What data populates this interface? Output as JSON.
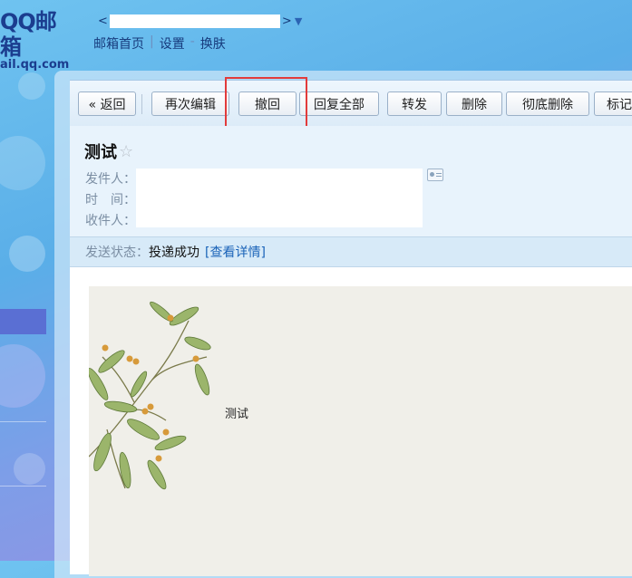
{
  "header": {
    "logo_main": "QQ邮箱",
    "logo_sub": "ail.qq.com",
    "account_open": "<",
    "account_close": ">",
    "account_caret": "▼",
    "nav": [
      {
        "label": "邮箱首页"
      },
      {
        "label": "设置"
      },
      {
        "label": "换肤"
      }
    ],
    "nav_separators": [
      "|",
      "-"
    ]
  },
  "toolbar": {
    "back": "« 返回",
    "reedit": "再次编辑",
    "recall": "撤回",
    "reply_all": "回复全部",
    "forward": "转发",
    "delete": "删除",
    "delete_forever": "彻底删除",
    "mark": "标记"
  },
  "mail": {
    "subject": "测试",
    "star": "☆",
    "from_label": "发件人：",
    "time_label": "时　间：",
    "to_label": "收件人：",
    "status_label": "发送状态：",
    "status_value": "投递成功",
    "status_link": "[查看详情]",
    "body_text": "测试"
  },
  "colors": {
    "highlight_border": "#e23b3b",
    "link": "#1a63b8",
    "brand": "#1b3d8f"
  }
}
